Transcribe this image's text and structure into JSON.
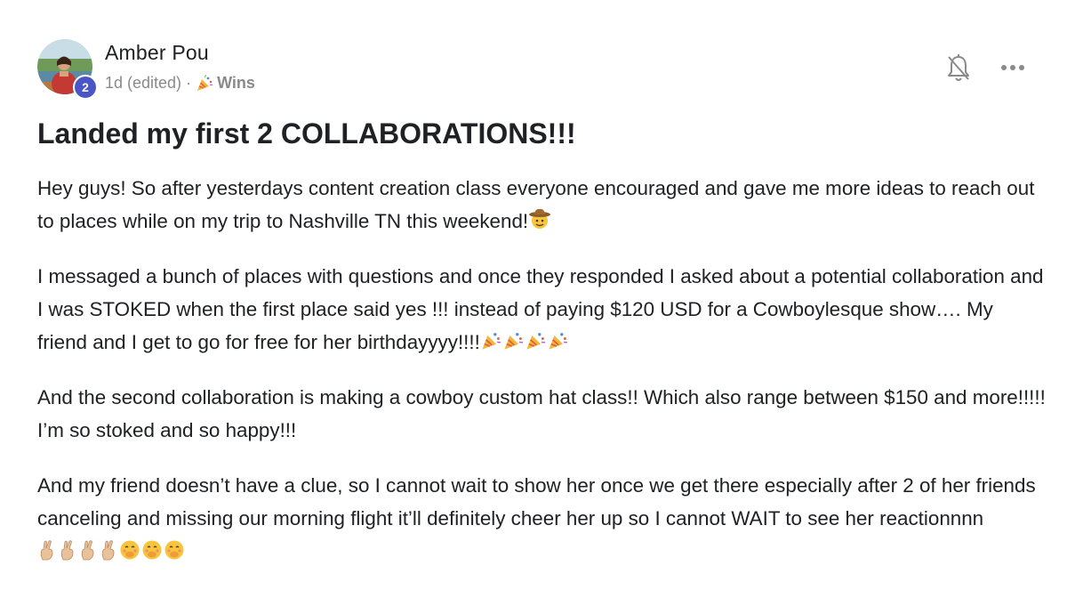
{
  "post": {
    "author": {
      "name": "Amber Pou",
      "level": "2"
    },
    "meta": {
      "time": "1d (edited)",
      "separator": "·",
      "category": "Wins",
      "category_icon": "party-popper-icon"
    },
    "actions": {
      "notifications_icon": "bell-off-icon",
      "more_icon": "more-horizontal-icon"
    },
    "title": "Landed my first 2 COLLABORATIONS!!!",
    "paragraphs": [
      {
        "text": "Hey guys! So after yesterdays content creation class everyone encouraged and gave me more ideas to reach out to places while on my trip to Nashville TN this weekend!",
        "emojis": [
          "cowboy-hat-face"
        ]
      },
      {
        "text": "I messaged a bunch of places with questions and once they responded I asked about a potential collaboration and I was STOKED when the first place said yes !!! instead of paying $120 USD for a Cowboylesque show…. My friend and I get to go for free for her birthdayyyy!!!!",
        "emojis": [
          "party-popper",
          "party-popper",
          "party-popper",
          "party-popper"
        ]
      },
      {
        "text": "And the second collaboration is making a cowboy custom hat class!! Which also range between $150 and more!!!!! I’m so stoked and so happy!!!",
        "emojis": []
      },
      {
        "text": "And my friend doesn’t have a clue, so I cannot wait to show her once we get there especially after 2 of her friends canceling and missing our morning flight it’ll definitely cheer her up so I cannot WAIT to see her reactionnnn",
        "emojis": [
          "crossed-fingers",
          "crossed-fingers",
          "crossed-fingers",
          "crossed-fingers",
          "hand-over-mouth-face",
          "hand-over-mouth-face",
          "hand-over-mouth-face"
        ]
      }
    ],
    "colors": {
      "level_badge": "#4a55c8",
      "meta_text": "#8a8a8a",
      "text": "#202124"
    }
  }
}
